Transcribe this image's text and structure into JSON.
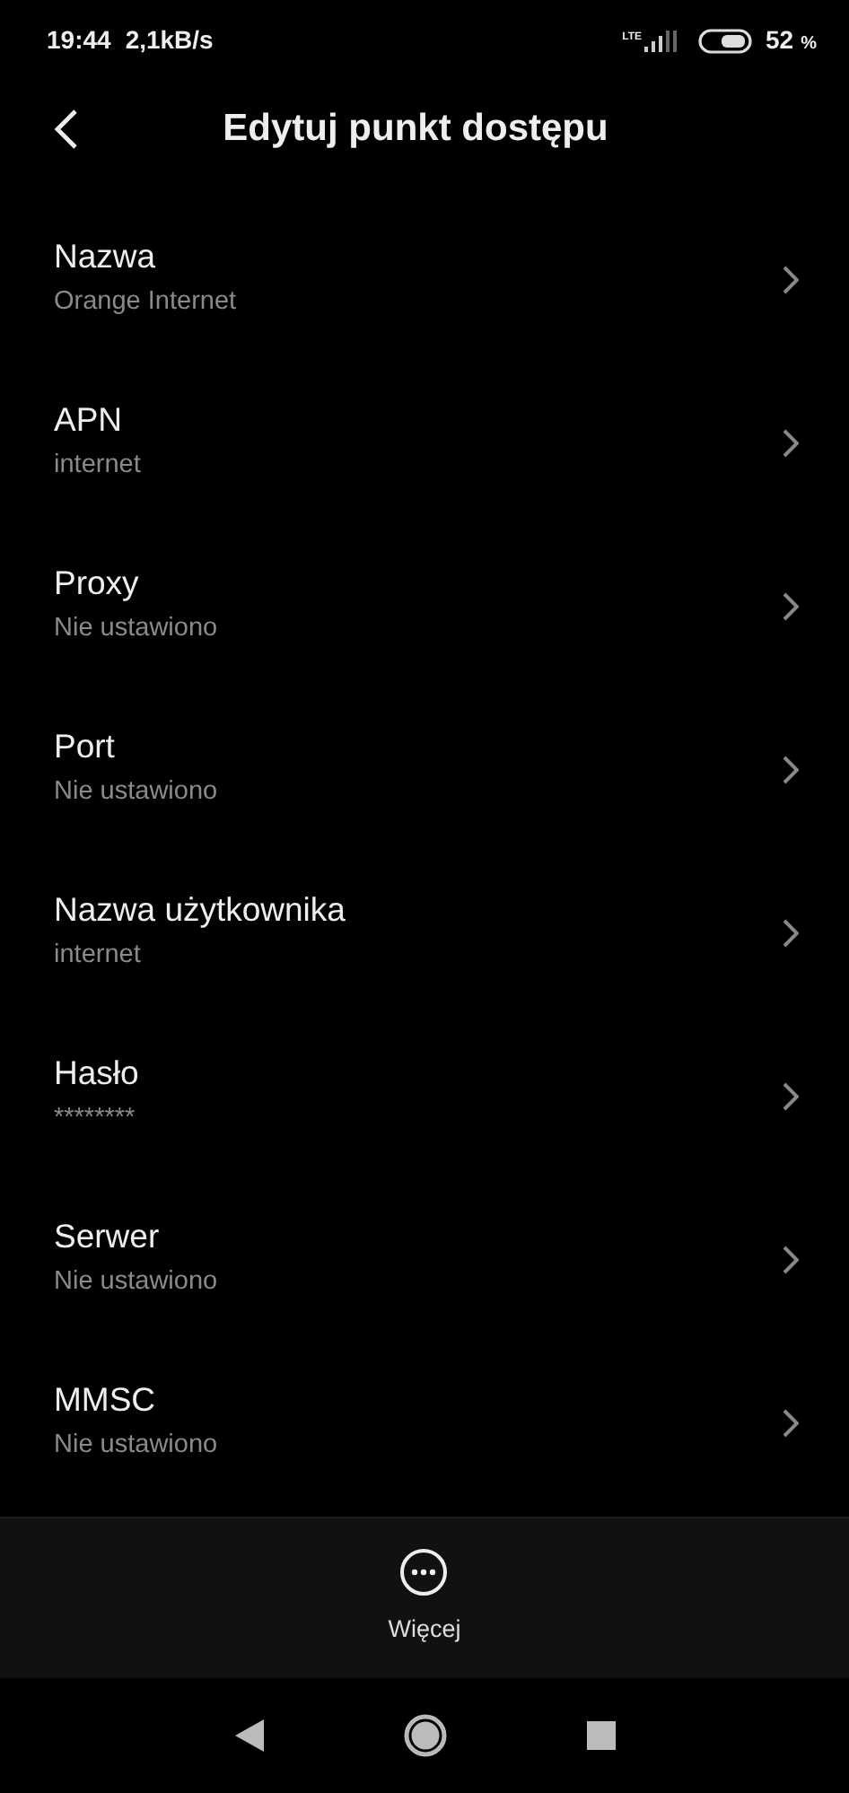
{
  "status_bar": {
    "time": "19:44",
    "speed": "2,1kB/s",
    "network": "LTE",
    "battery": "52",
    "battery_unit": "%"
  },
  "header": {
    "title": "Edytuj punkt dostępu"
  },
  "items": [
    {
      "label": "Nazwa",
      "value": "Orange Internet"
    },
    {
      "label": "APN",
      "value": "internet"
    },
    {
      "label": "Proxy",
      "value": "Nie ustawiono"
    },
    {
      "label": "Port",
      "value": "Nie ustawiono"
    },
    {
      "label": "Nazwa użytkownika",
      "value": "internet"
    },
    {
      "label": "Hasło",
      "value": "********"
    },
    {
      "label": "Serwer",
      "value": "Nie ustawiono"
    },
    {
      "label": "MMSC",
      "value": "Nie ustawiono"
    }
  ],
  "bottom_bar": {
    "label": "Więcej"
  }
}
